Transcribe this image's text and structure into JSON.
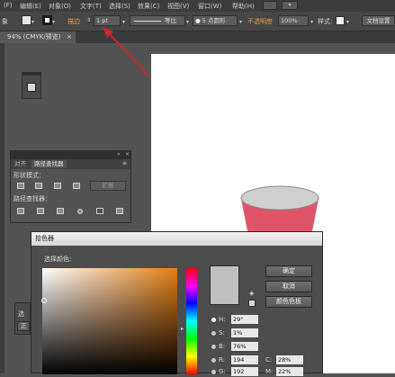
{
  "menu": {
    "items": [
      "(F)",
      "编辑(E)",
      "对象(O)",
      "文字(T)",
      "选择(S)",
      "效果(C)",
      "视图(V)",
      "窗口(W)",
      "帮助(H)"
    ],
    "workspace_switcher": "▾"
  },
  "control_bar": {
    "left_glyph": "象",
    "stroke_label": "描边",
    "stroke_weight": "1 pt",
    "stroke_profile": "等比",
    "brush_def": "5 点圆形",
    "opacity_label": "不透明度",
    "opacity_value": "100%",
    "style_label": "样式:",
    "doc_setup_button": "文档设置"
  },
  "doc_tab": {
    "label": "94% (CMYK/预览)",
    "close": "×"
  },
  "pathfinder_panel": {
    "tab_transform": "对齐",
    "tab_pathfinder": "路径查找器",
    "shape_modes_label": "形状模式：",
    "expand_button": "扩展",
    "pathfinders_label": "路径查找器："
  },
  "side_panel": {
    "label": "选",
    "button": "正"
  },
  "color_picker": {
    "title": "拾色器",
    "select_color_label": "选择颜色:",
    "ok_button": "确定",
    "cancel_button": "取消",
    "swatches_button": "颜色色板",
    "fields": [
      {
        "label": "H:",
        "value": "29°"
      },
      {
        "label": "S:",
        "value": "1%"
      },
      {
        "label": "B:",
        "value": "76%"
      },
      {
        "label": "R:",
        "value": "194"
      },
      {
        "label": "G:",
        "value": "192"
      }
    ],
    "cmyk_fields": [
      {
        "label": "C:",
        "value": "28%"
      },
      {
        "label": "M:",
        "value": "22%"
      }
    ],
    "colors": {
      "spectrum_hue": "#e37d13",
      "current_swatch": "#c2c0be"
    }
  },
  "colors": {
    "annotation_arrow": "#d0242b",
    "cup_body": "#e0546a",
    "cup_top": "#cfcfcf"
  }
}
